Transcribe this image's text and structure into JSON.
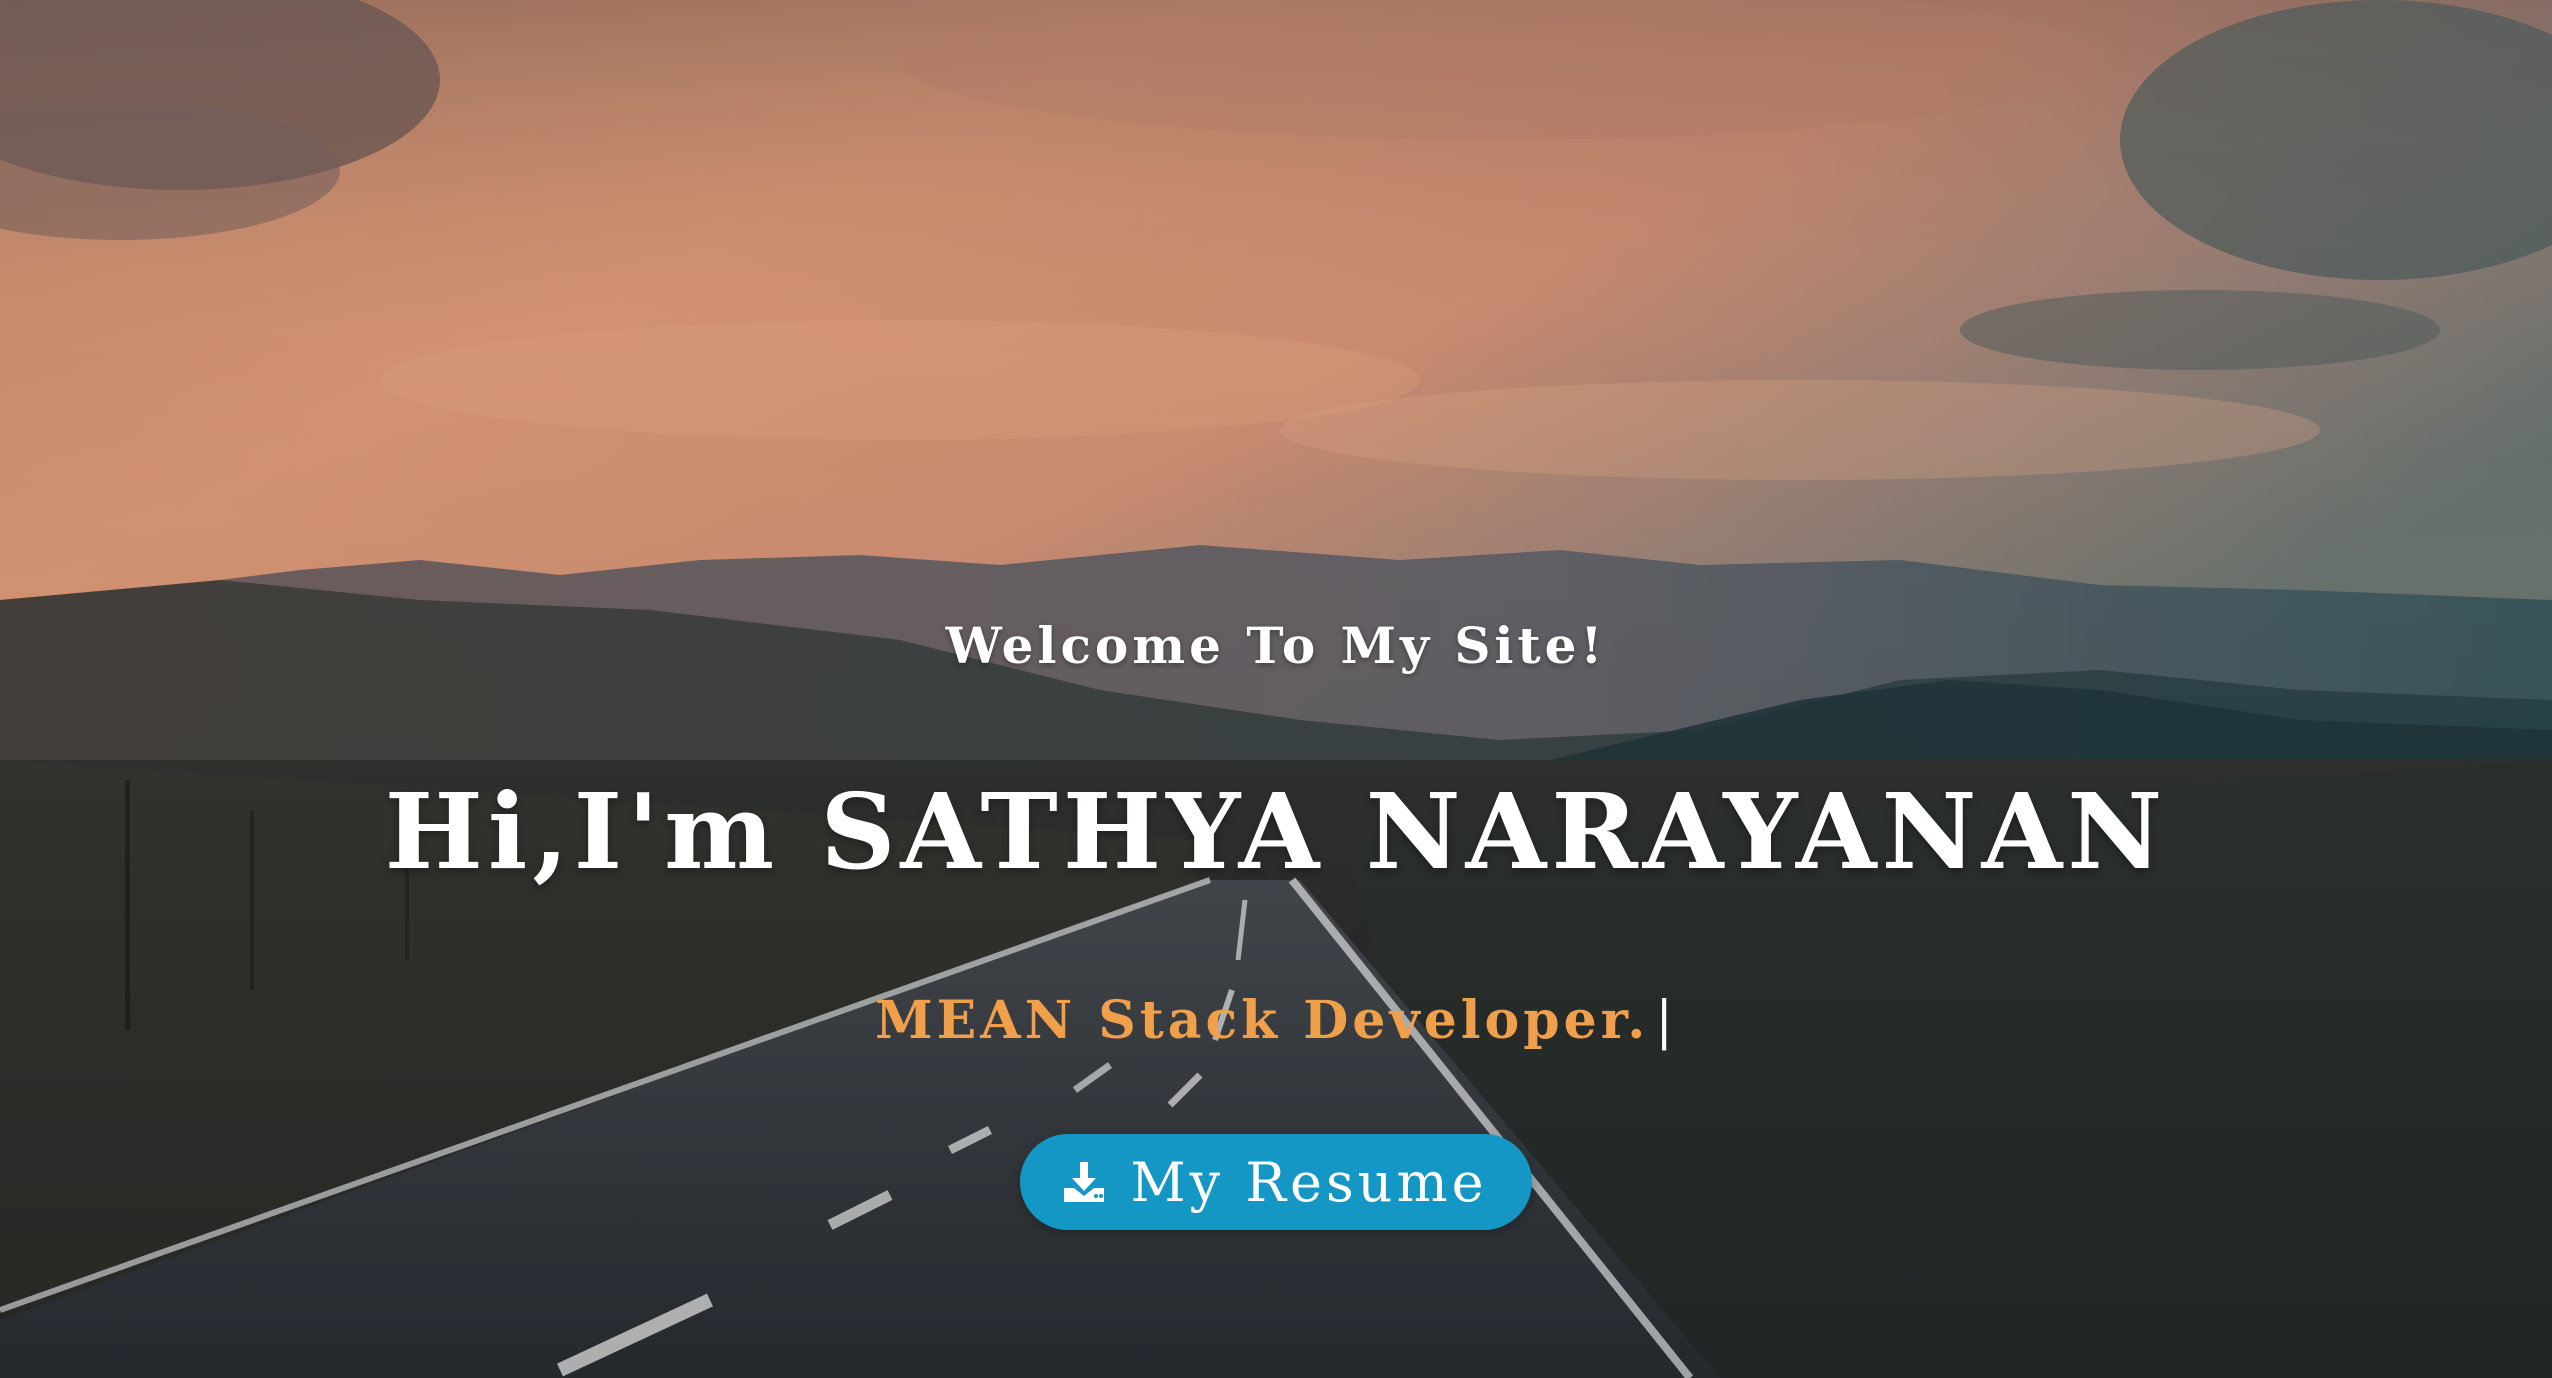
{
  "hero": {
    "welcome_text": "Welcome To My Site!",
    "name_text": "Hi,I'm SATHYA NARAYANAN",
    "role_text": "MEAN Stack Developer.",
    "cursor": "|",
    "resume_button": {
      "label": "My Resume",
      "icon": "download-icon"
    }
  },
  "colors": {
    "accent": "#1497c4",
    "role_text": "#f0a04b",
    "heading_text": "#ffffff"
  }
}
